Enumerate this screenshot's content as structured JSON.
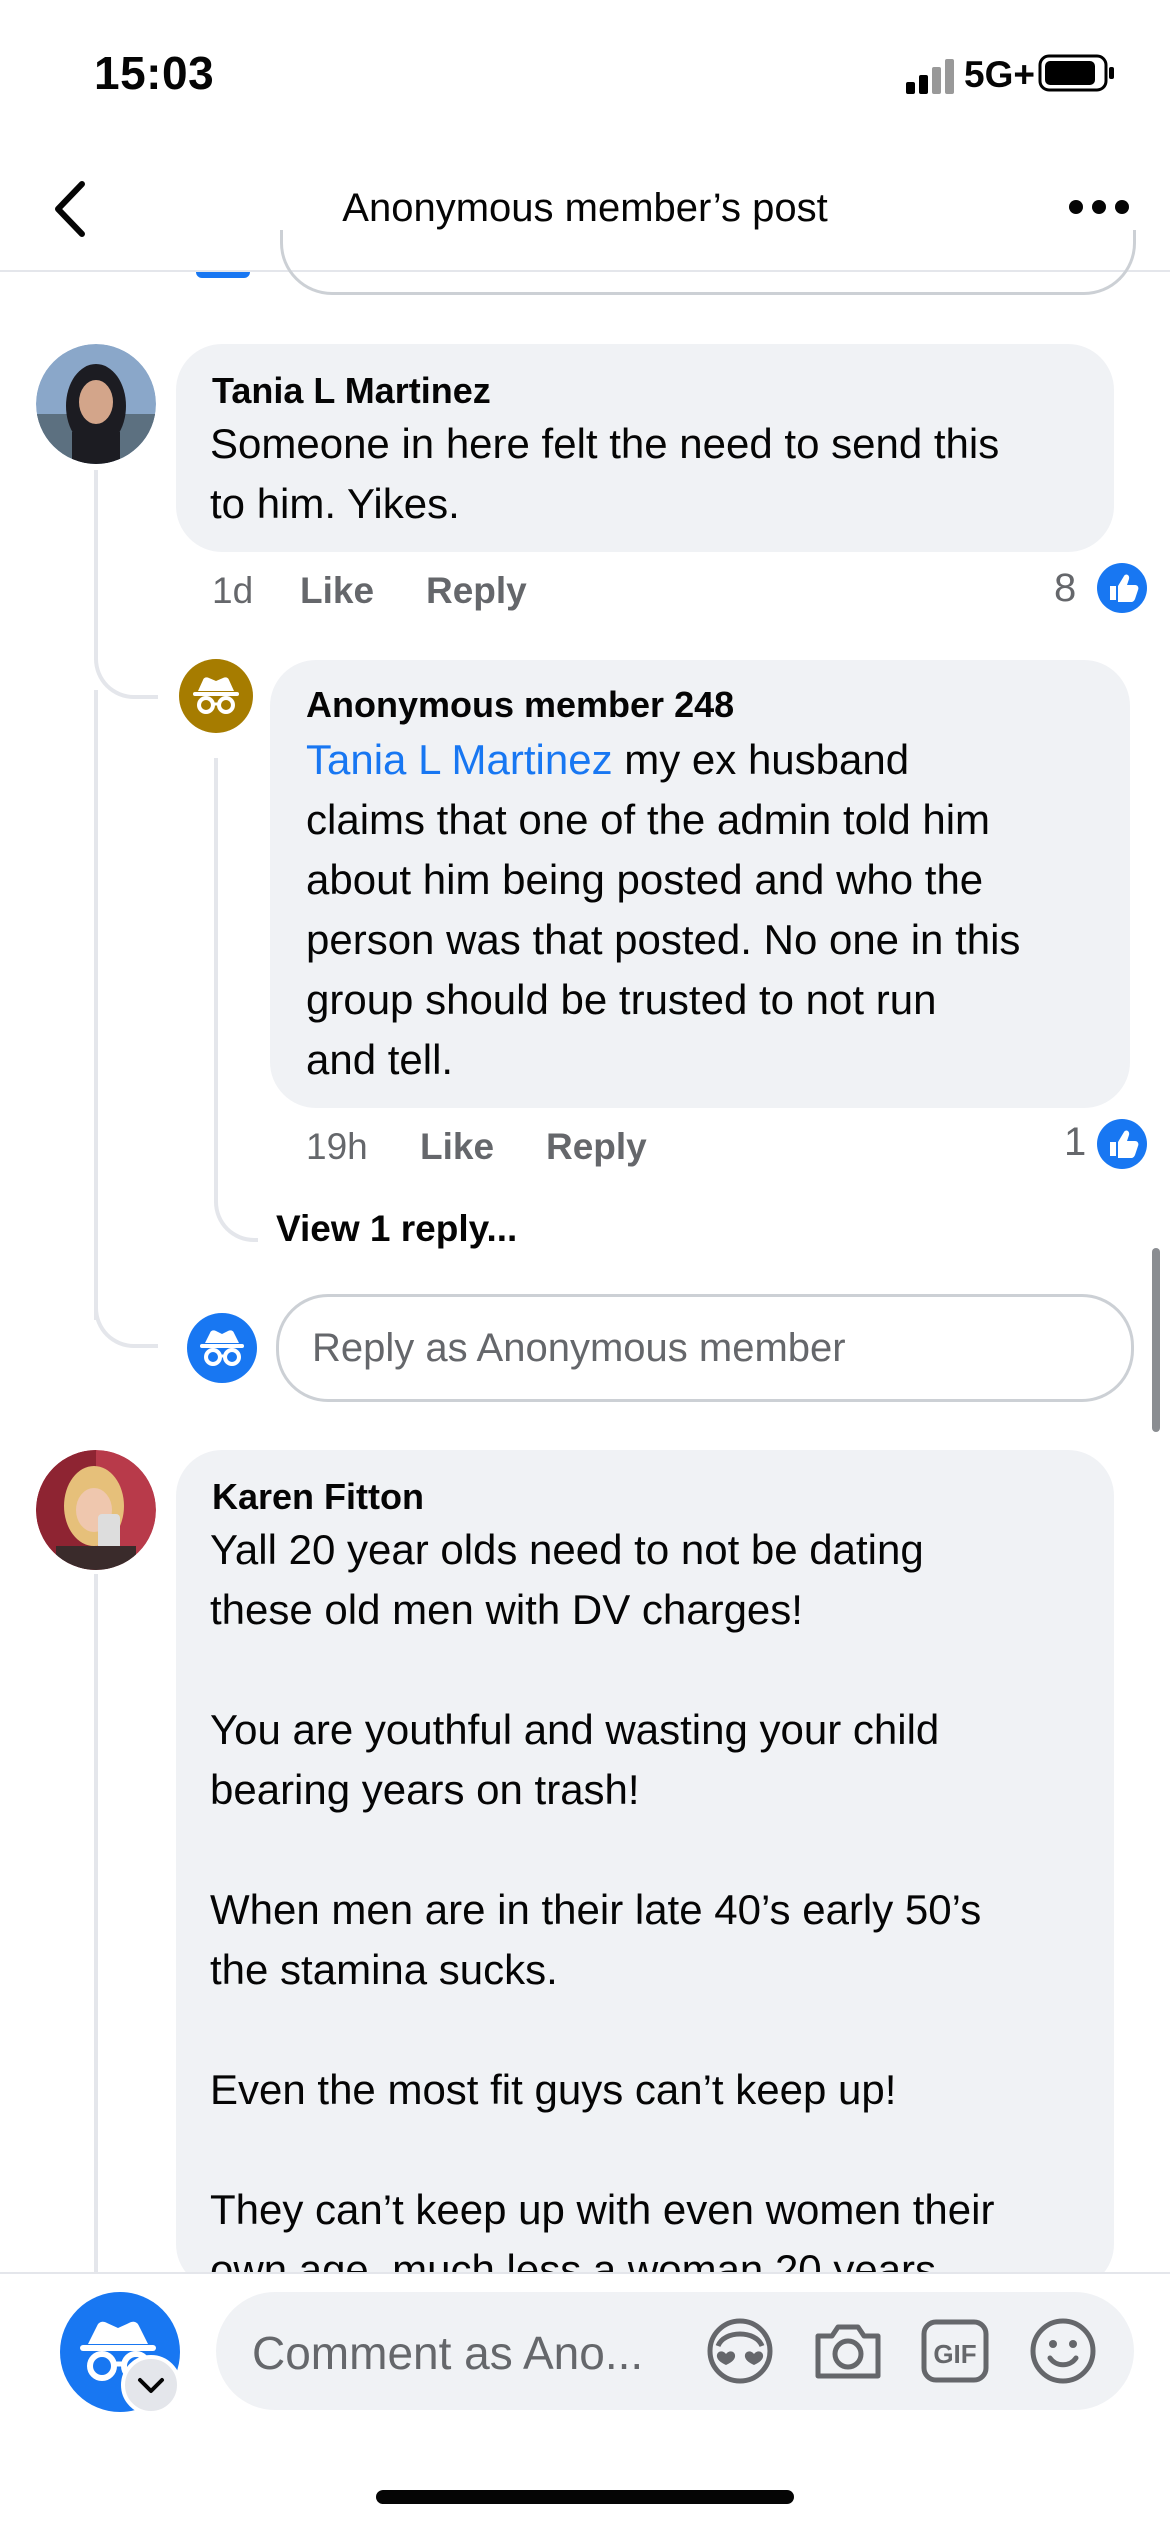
{
  "status_bar": {
    "time": "15:03",
    "network": "5G+"
  },
  "header": {
    "title": "Anonymous member’s post"
  },
  "comments": [
    {
      "author": "Tania L Martinez",
      "text": "Someone in here felt the need to send this\nto him. Yikes.",
      "time": "1d",
      "like_label": "Like",
      "reply_label": "Reply",
      "reactions": "8",
      "replies": [
        {
          "author": "Anonymous member 248",
          "mention": "Tania L Martinez",
          "text_first_line": " my ex husband",
          "text_rest": "claims that one of the admin told him\nabout him being posted and who the\nperson was that posted. No one in this\ngroup should be trusted to not run\nand tell.",
          "time": "19h",
          "like_label": "Like",
          "reply_label": "Reply",
          "reactions": "1"
        }
      ],
      "view_replies": "View 1 reply...",
      "reply_placeholder": "Reply as Anonymous member"
    },
    {
      "author": "Karen Fitton",
      "text": "Yall 20 year olds need to not be dating\nthese old men with DV charges!\n\nYou are youthful and wasting your child\nbearing years on trash!\n\nWhen men are in their late 40’s early 50’s\nthe stamina sucks.\n\nEven the most fit guys can’t keep up!\n\nThey can’t keep up with even women their\nown age, much less a woman 20 years"
    }
  ],
  "composer": {
    "placeholder": "Comment as Ano..."
  },
  "colors": {
    "accent": "#1877f2",
    "bubble": "#f0f2f5",
    "gold": "#a67c00"
  }
}
